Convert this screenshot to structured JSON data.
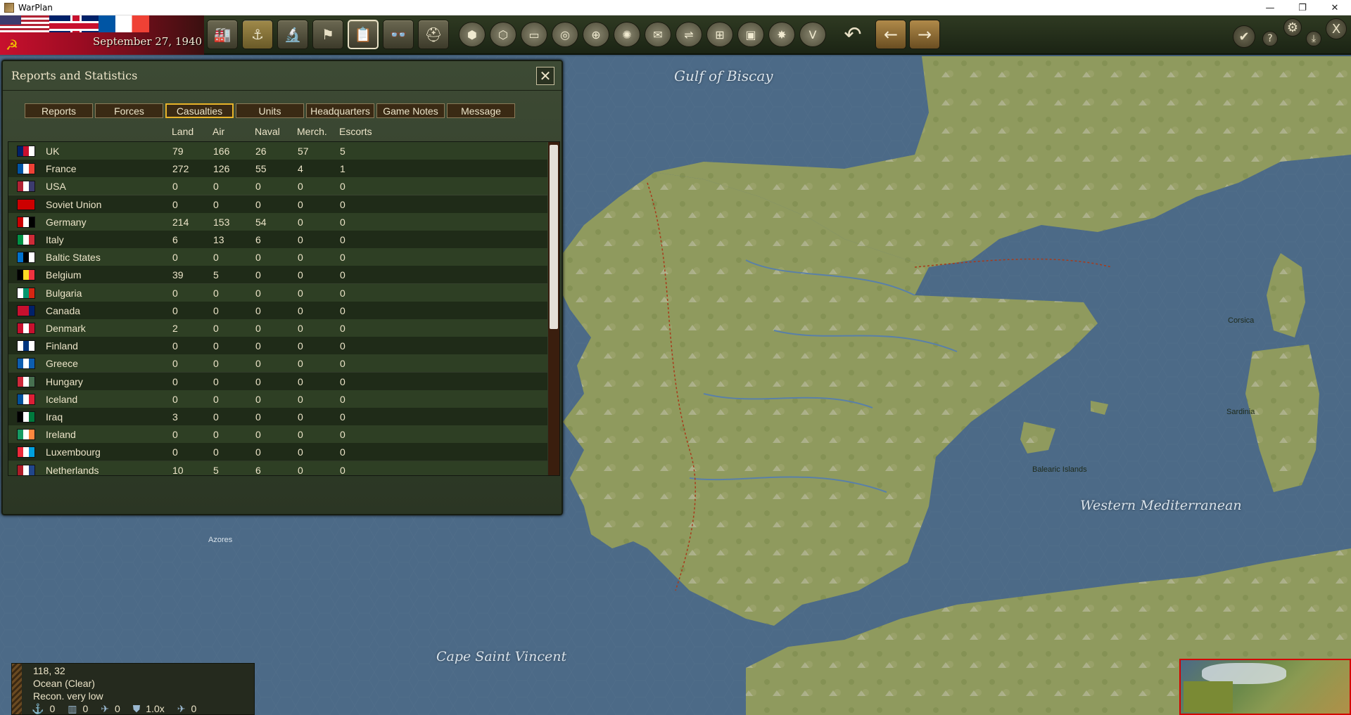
{
  "window": {
    "title": "WarPlan",
    "minimize": "—",
    "restore": "❐",
    "close": "✕"
  },
  "topbar": {
    "date": "September 27, 1940",
    "buttons": [
      {
        "name": "production",
        "icon": "factory-icon",
        "glyph": "🏭"
      },
      {
        "name": "naval",
        "icon": "ship-icon",
        "glyph": "⚓"
      },
      {
        "name": "research",
        "icon": "microscope-icon",
        "glyph": "🔬"
      },
      {
        "name": "objectives",
        "icon": "flag-icon",
        "glyph": "⚑"
      },
      {
        "name": "reports",
        "icon": "clipboard-icon",
        "glyph": "📋"
      },
      {
        "name": "recon",
        "icon": "binoculars-icon",
        "glyph": "👓"
      },
      {
        "name": "units",
        "icon": "helmet-icon",
        "glyph": "⛑"
      }
    ],
    "filters": [
      "⬢",
      "⬡",
      "▭",
      "◎",
      "⊕",
      "✺",
      "✉",
      "⇌",
      "⊞",
      "▣",
      "✸",
      "V"
    ],
    "undo": "↶",
    "prev": "←",
    "next": "→",
    "confirm": "✔",
    "help": "?",
    "settings": "⚙",
    "save": "⤓",
    "exit": "X"
  },
  "map": {
    "labels": [
      {
        "text": "Gulf of Biscay",
        "kind": "sea"
      },
      {
        "text": "Western Mediterranean",
        "kind": "sea"
      },
      {
        "text": "Cape Saint Vincent",
        "kind": "sea"
      },
      {
        "text": "Azores",
        "kind": "land"
      },
      {
        "text": "Balearic Islands",
        "kind": "land"
      },
      {
        "text": "Corsica",
        "kind": "land"
      },
      {
        "text": "Sardinia",
        "kind": "land"
      }
    ]
  },
  "panel": {
    "title": "Reports and Statistics",
    "close": "✕",
    "tabs": [
      "Reports",
      "Forces",
      "Casualties",
      "Units",
      "Headquarters",
      "Game Notes",
      "Message"
    ],
    "active_tab": "Casualties",
    "columns": [
      "Land",
      "Air",
      "Naval",
      "Merch.",
      "Escorts"
    ],
    "rows": [
      {
        "country": "UK",
        "flag": [
          "#012169",
          "#c8102e",
          "#ffffff"
        ],
        "land": "79",
        "air": "166",
        "naval": "26",
        "merch": "57",
        "escorts": "5"
      },
      {
        "country": "France",
        "flag": [
          "#0055a4",
          "#ffffff",
          "#ef4135"
        ],
        "land": "272",
        "air": "126",
        "naval": "55",
        "merch": "4",
        "escorts": "1"
      },
      {
        "country": "USA",
        "flag": [
          "#b22234",
          "#ffffff",
          "#3c3b6e"
        ],
        "land": "0",
        "air": "0",
        "naval": "0",
        "merch": "0",
        "escorts": "0"
      },
      {
        "country": "Soviet Union",
        "flag": [
          "#cc0000",
          "#cc0000",
          "#cc0000"
        ],
        "land": "0",
        "air": "0",
        "naval": "0",
        "merch": "0",
        "escorts": "0"
      },
      {
        "country": "Germany",
        "flag": [
          "#cc0000",
          "#ffffff",
          "#000000"
        ],
        "land": "214",
        "air": "153",
        "naval": "54",
        "merch": "0",
        "escorts": "0"
      },
      {
        "country": "Italy",
        "flag": [
          "#009246",
          "#ffffff",
          "#ce2b37"
        ],
        "land": "6",
        "air": "13",
        "naval": "6",
        "merch": "0",
        "escorts": "0"
      },
      {
        "country": "Baltic States",
        "flag": [
          "#0072ce",
          "#000000",
          "#ffffff"
        ],
        "land": "0",
        "air": "0",
        "naval": "0",
        "merch": "0",
        "escorts": "0"
      },
      {
        "country": "Belgium",
        "flag": [
          "#000000",
          "#fdda24",
          "#ef3340"
        ],
        "land": "39",
        "air": "5",
        "naval": "0",
        "merch": "0",
        "escorts": "0"
      },
      {
        "country": "Bulgaria",
        "flag": [
          "#ffffff",
          "#00966e",
          "#d62612"
        ],
        "land": "0",
        "air": "0",
        "naval": "0",
        "merch": "0",
        "escorts": "0"
      },
      {
        "country": "Canada",
        "flag": [
          "#c8102e",
          "#c8102e",
          "#012169"
        ],
        "land": "0",
        "air": "0",
        "naval": "0",
        "merch": "0",
        "escorts": "0"
      },
      {
        "country": "Denmark",
        "flag": [
          "#c8102e",
          "#ffffff",
          "#c8102e"
        ],
        "land": "2",
        "air": "0",
        "naval": "0",
        "merch": "0",
        "escorts": "0"
      },
      {
        "country": "Finland",
        "flag": [
          "#ffffff",
          "#003580",
          "#ffffff"
        ],
        "land": "0",
        "air": "0",
        "naval": "0",
        "merch": "0",
        "escorts": "0"
      },
      {
        "country": "Greece",
        "flag": [
          "#0d5eaf",
          "#ffffff",
          "#0d5eaf"
        ],
        "land": "0",
        "air": "0",
        "naval": "0",
        "merch": "0",
        "escorts": "0"
      },
      {
        "country": "Hungary",
        "flag": [
          "#ce2939",
          "#ffffff",
          "#477050"
        ],
        "land": "0",
        "air": "0",
        "naval": "0",
        "merch": "0",
        "escorts": "0"
      },
      {
        "country": "Iceland",
        "flag": [
          "#02529c",
          "#ffffff",
          "#dc1e35"
        ],
        "land": "0",
        "air": "0",
        "naval": "0",
        "merch": "0",
        "escorts": "0"
      },
      {
        "country": "Iraq",
        "flag": [
          "#000000",
          "#ffffff",
          "#007a3d"
        ],
        "land": "3",
        "air": "0",
        "naval": "0",
        "merch": "0",
        "escorts": "0"
      },
      {
        "country": "Ireland",
        "flag": [
          "#169b62",
          "#ffffff",
          "#ff883e"
        ],
        "land": "0",
        "air": "0",
        "naval": "0",
        "merch": "0",
        "escorts": "0"
      },
      {
        "country": "Luxembourg",
        "flag": [
          "#ed2939",
          "#ffffff",
          "#00a1de"
        ],
        "land": "0",
        "air": "0",
        "naval": "0",
        "merch": "0",
        "escorts": "0"
      },
      {
        "country": "Netherlands",
        "flag": [
          "#ae1c28",
          "#ffffff",
          "#21468b"
        ],
        "land": "10",
        "air": "5",
        "naval": "6",
        "merch": "0",
        "escorts": "0"
      }
    ]
  },
  "info": {
    "coords": "118, 32",
    "terrain": "Ocean (Clear)",
    "recon": "Recon. very low",
    "stats": [
      {
        "icon": "anchor-icon",
        "glyph": "⚓",
        "value": "0"
      },
      {
        "icon": "supply-icon",
        "glyph": "▥",
        "value": "0"
      },
      {
        "icon": "air-icon",
        "glyph": "✈",
        "value": "0"
      },
      {
        "icon": "shield-icon",
        "glyph": "⛊",
        "value": "1.0x"
      },
      {
        "icon": "plane-icon",
        "glyph": "✈",
        "value": "0"
      }
    ]
  },
  "colors": {
    "panel_bg": "#2e3f24",
    "accent_gold": "#e8b32a",
    "sea": "#4c6a87",
    "land": "#8f9a5e"
  }
}
